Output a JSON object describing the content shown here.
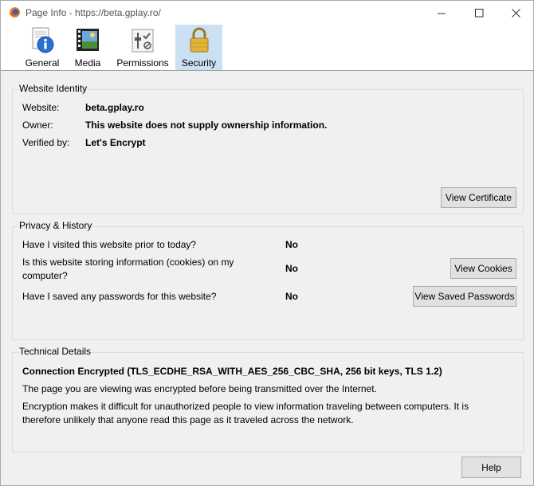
{
  "window": {
    "title": "Page Info - https://beta.gplay.ro/",
    "controls": {
      "minimize": "minimize-icon",
      "maximize": "maximize-icon",
      "close": "close-icon"
    }
  },
  "toolbar": {
    "tabs": [
      {
        "label": "General",
        "icon": "info-icon"
      },
      {
        "label": "Media",
        "icon": "film-icon"
      },
      {
        "label": "Permissions",
        "icon": "permissions-icon"
      },
      {
        "label": "Security",
        "icon": "padlock-icon",
        "selected": true
      }
    ]
  },
  "identity": {
    "heading": "Website Identity",
    "website_label": "Website:",
    "website_value": "beta.gplay.ro",
    "owner_label": "Owner:",
    "owner_value": "This website does not supply ownership information.",
    "verified_label": "Verified by:",
    "verified_value": "Let's Encrypt",
    "view_certificate": "View Certificate"
  },
  "privacy": {
    "heading": "Privacy & History",
    "visited_q": "Have I visited this website prior to today?",
    "visited_a": "No",
    "cookies_q_line1": "Is this website storing information (cookies) on my",
    "cookies_q_line2": "computer?",
    "cookies_a": "No",
    "view_cookies": "View Cookies",
    "passwords_q": "Have I saved any passwords for this website?",
    "passwords_a": "No",
    "view_passwords": "View Saved Passwords"
  },
  "technical": {
    "heading": "Technical Details",
    "connection": "Connection Encrypted (TLS_ECDHE_RSA_WITH_AES_256_CBC_SHA, 256 bit keys, TLS 1.2)",
    "para1": "The page you are viewing was encrypted before being transmitted over the Internet.",
    "para2_line1": "Encryption makes it difficult for unauthorized people to view information traveling between computers. It is",
    "para2_line2": "therefore unlikely that anyone read this page as it traveled across the network."
  },
  "footer": {
    "help": "Help"
  },
  "colors": {
    "selected_tab": "#cce0f4",
    "button_face": "#e1e1e1",
    "dialog_bg": "#f0f0f0"
  }
}
